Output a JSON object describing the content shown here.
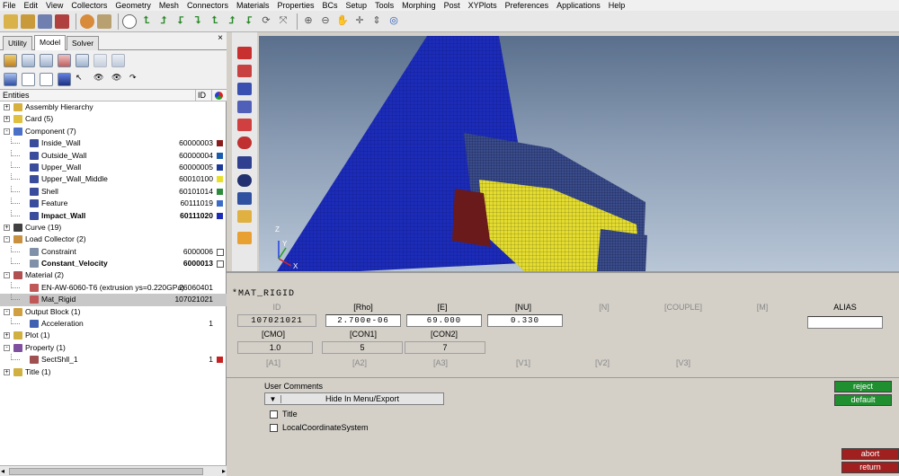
{
  "menu": [
    "File",
    "Edit",
    "View",
    "Collectors",
    "Geometry",
    "Mesh",
    "Connectors",
    "Materials",
    "Properties",
    "BCs",
    "Setup",
    "Tools",
    "Morphing",
    "Post",
    "XYPlots",
    "Preferences",
    "Applications",
    "Help"
  ],
  "tabs": {
    "utility": "Utility",
    "model": "Model",
    "solver": "Solver",
    "close": "×"
  },
  "entities_header": {
    "entities": "Entities",
    "id": "ID"
  },
  "tree": [
    {
      "level": 0,
      "expander": "+",
      "label": "Assembly Hierarchy",
      "id": "",
      "icon": "assembly-icon",
      "bold": false
    },
    {
      "level": 0,
      "expander": "+",
      "label": "Card (5)",
      "id": "",
      "icon": "card-icon",
      "bold": false
    },
    {
      "level": 0,
      "expander": "-",
      "label": "Component (7)",
      "id": "",
      "icon": "component-icon",
      "bold": false
    },
    {
      "level": 1,
      "expander": "",
      "label": "Inside_Wall",
      "id": "60000003",
      "icon": "component-item-icon",
      "swatch": "#8b1c1c",
      "bold": false
    },
    {
      "level": 1,
      "expander": "",
      "label": "Outside_Wall",
      "id": "60000004",
      "icon": "component-item-icon",
      "swatch": "#1c5cae",
      "bold": false
    },
    {
      "level": 1,
      "expander": "",
      "label": "Upper_Wall",
      "id": "60000005",
      "icon": "component-item-icon",
      "swatch": "#1c3a9a",
      "bold": false
    },
    {
      "level": 1,
      "expander": "",
      "label": "Upper_Wall_Middle",
      "id": "60010100",
      "icon": "component-item-icon",
      "swatch": "#e8e02c",
      "bold": false
    },
    {
      "level": 1,
      "expander": "",
      "label": "Shell",
      "id": "60101014",
      "icon": "component-item-icon",
      "swatch": "#2c8c3c",
      "bold": false
    },
    {
      "level": 1,
      "expander": "",
      "label": "Feature",
      "id": "60111019",
      "icon": "component-item-icon",
      "swatch": "#3c6cc8",
      "bold": false
    },
    {
      "level": 1,
      "expander": "",
      "label": "Impact_Wall",
      "id": "60111020",
      "icon": "component-item-icon",
      "swatch": "#1c2cb8",
      "bold": true
    },
    {
      "level": 0,
      "expander": "+",
      "label": "Curve (19)",
      "id": "",
      "icon": "curve-icon",
      "bold": false
    },
    {
      "level": 0,
      "expander": "-",
      "label": "Load Collector (2)",
      "id": "",
      "icon": "load-collector-icon",
      "bold": false
    },
    {
      "level": 1,
      "expander": "",
      "label": "Constraint",
      "id": "6000006",
      "icon": "load-item-icon",
      "check": true,
      "bold": false
    },
    {
      "level": 1,
      "expander": "",
      "label": "Constant_Velocity",
      "id": "6000013",
      "icon": "load-item-icon",
      "check": true,
      "bold": true
    },
    {
      "level": 0,
      "expander": "-",
      "label": "Material (2)",
      "id": "",
      "icon": "material-icon",
      "bold": false
    },
    {
      "level": 1,
      "expander": "",
      "label": "EN-AW-6060-T6 (extrusion ys=0.220GPa)",
      "id": "26060401",
      "icon": "material-item-icon",
      "bold": false
    },
    {
      "level": 1,
      "expander": "",
      "label": "Mat_Rigid",
      "id": "107021021",
      "icon": "material-item-icon",
      "bold": false,
      "highlight": true
    },
    {
      "level": 0,
      "expander": "-",
      "label": "Output Block (1)",
      "id": "",
      "icon": "output-block-icon",
      "bold": false
    },
    {
      "level": 1,
      "expander": "",
      "label": "Acceleration",
      "id": "1",
      "icon": "output-item-icon",
      "bold": false
    },
    {
      "level": 0,
      "expander": "+",
      "label": "Plot (1)",
      "id": "",
      "icon": "plot-icon",
      "bold": false
    },
    {
      "level": 0,
      "expander": "-",
      "label": "Property (1)",
      "id": "",
      "icon": "property-icon",
      "bold": false
    },
    {
      "level": 1,
      "expander": "",
      "label": "SectShll_1",
      "id": "1",
      "icon": "property-item-icon",
      "swatch": "#c82020",
      "bold": false
    },
    {
      "level": 0,
      "expander": "+",
      "label": "Title (1)",
      "id": "",
      "icon": "title-icon",
      "bold": false
    }
  ],
  "graphics": {
    "axis_x": "X",
    "axis_y": "Y",
    "axis_z": "Z"
  },
  "card": {
    "name": "*MAT_RIGID",
    "row1_headers": [
      "ID",
      "[Rho]",
      "[E]",
      "[NU]",
      "[N]",
      "[COUPLE]",
      "[M]",
      "ALIAS"
    ],
    "row1_values": [
      "107021021",
      "2.700e-06",
      "69.000",
      "0.330"
    ],
    "row2_headers": [
      "[CMO]",
      "[CON1]",
      "[CON2]"
    ],
    "row2_values": [
      "1.0",
      "5",
      "7"
    ],
    "row3_headers": [
      "[A1]",
      "[A2]",
      "[A3]",
      "[V1]",
      "[V2]",
      "[V3]"
    ]
  },
  "comments": {
    "label": "User Comments",
    "hide_button": "Hide In Menu/Export",
    "title_cb": "Title",
    "lcs_cb": "LocalCoordinateSystem"
  },
  "buttons": {
    "reject": "reject",
    "default": "default",
    "abort": "abort",
    "return": "return"
  },
  "colors": {
    "accent_green": "#1f8f2f",
    "accent_red": "#a02020",
    "mesh_yellow": "#e8e02c",
    "wall_blue": "#1c2cb8"
  }
}
